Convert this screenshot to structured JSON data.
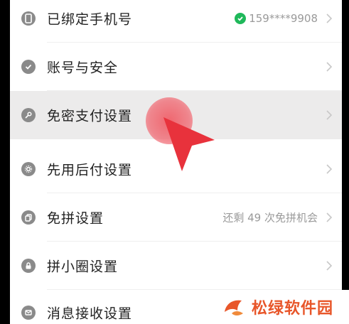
{
  "settings": {
    "items": [
      {
        "label": "已绑定手机号",
        "value": "159****9908",
        "icon": "phone-icon"
      },
      {
        "label": "账号与安全",
        "value": "",
        "icon": "shield-check-icon"
      },
      {
        "label": "免密支付设置",
        "value": "",
        "icon": "key-icon"
      },
      {
        "label": "先用后付设置",
        "value": "",
        "icon": "gear-icon"
      },
      {
        "label": "免拼设置",
        "value": "还剩 49 次免拼机会",
        "icon": "copy-icon"
      },
      {
        "label": "拼小圈设置",
        "value": "",
        "icon": "lock-icon"
      },
      {
        "label": "消息接收设置",
        "value": "",
        "icon": "message-icon"
      }
    ]
  },
  "watermark": {
    "text": "松绿软件园"
  },
  "colors": {
    "accent_green": "#1fb85a",
    "pointer_red": "#e8323c",
    "watermark_orange": "#e8562a"
  }
}
